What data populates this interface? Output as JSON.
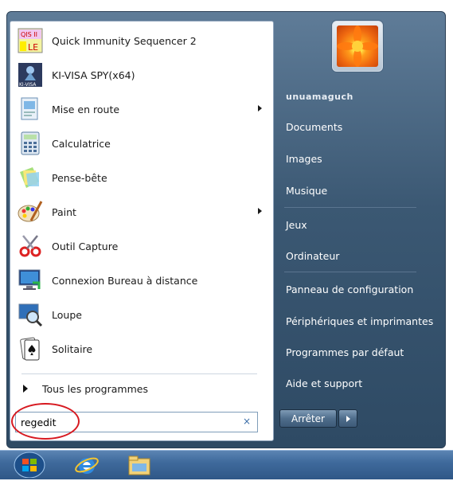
{
  "programs": [
    {
      "label": "Quick Immunity Sequencer 2",
      "icon": "qis-le-icon",
      "arrow": false
    },
    {
      "label": "KI-VISA SPY(x64)",
      "icon": "ki-visa-spy-icon",
      "arrow": false
    },
    {
      "label": "Mise en route",
      "icon": "getting-started-icon",
      "arrow": true
    },
    {
      "label": "Calculatrice",
      "icon": "calculator-icon",
      "arrow": false
    },
    {
      "label": "Pense-bête",
      "icon": "sticky-notes-icon",
      "arrow": false
    },
    {
      "label": "Paint",
      "icon": "paint-icon",
      "arrow": true
    },
    {
      "label": "Outil Capture",
      "icon": "snipping-tool-icon",
      "arrow": false
    },
    {
      "label": "Connexion Bureau à distance",
      "icon": "remote-desktop-icon",
      "arrow": false
    },
    {
      "label": "Loupe",
      "icon": "magnifier-icon",
      "arrow": false
    },
    {
      "label": "Solitaire",
      "icon": "solitaire-icon",
      "arrow": false
    }
  ],
  "qis_icon_text": {
    "top": "QIS II",
    "bottom": "LE"
  },
  "kivisa_icon_text": "KI-VISA",
  "all_programs": "Tous les programmes",
  "search": {
    "value": "regedit",
    "clear": "×"
  },
  "right": {
    "user": "unuamaguch",
    "documents": "Documents",
    "images": "Images",
    "music": "Musique",
    "games": "Jeux",
    "computer": "Ordinateur",
    "control_panel": "Panneau de configuration",
    "devices": "Périphériques et imprimantes",
    "default_programs": "Programmes par défaut",
    "help": "Aide et support"
  },
  "shutdown_label": "Arrêter",
  "colors": {
    "highlight": "#d71920",
    "menu_bg": "#3b5873",
    "taskbar": "#3f6a9c"
  }
}
